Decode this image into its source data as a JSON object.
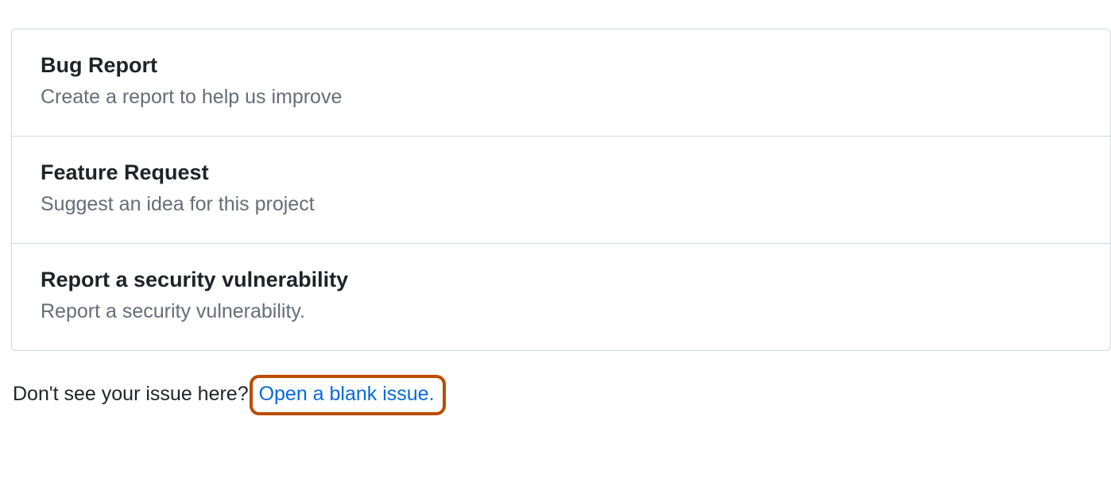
{
  "templates": [
    {
      "title": "Bug Report",
      "description": "Create a report to help us improve"
    },
    {
      "title": "Feature Request",
      "description": "Suggest an idea for this project"
    },
    {
      "title": "Report a security vulnerability",
      "description": "Report a security vulnerability."
    }
  ],
  "footer": {
    "prompt": "Don't see your issue here? ",
    "link_text": "Open a blank issue."
  }
}
